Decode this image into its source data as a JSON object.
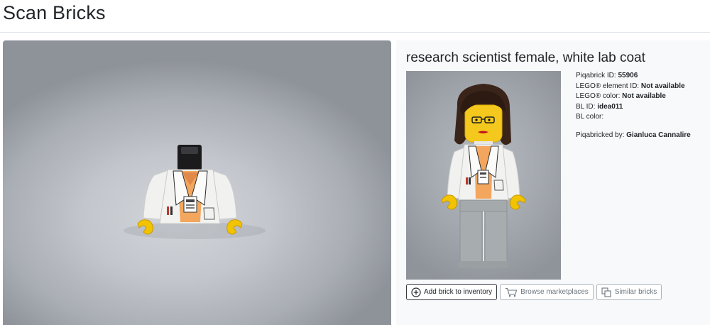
{
  "header": {
    "title": "Scan Bricks"
  },
  "brick": {
    "name": "research scientist female, white lab coat",
    "fields": [
      {
        "label": "Piqabrick ID: ",
        "value": "55906"
      },
      {
        "label": "LEGO® element ID: ",
        "value": "Not available"
      },
      {
        "label": "LEGO® color: ",
        "value": "Not available"
      },
      {
        "label": "BL ID: ",
        "value": "idea011"
      },
      {
        "label": "BL color: ",
        "value": ""
      }
    ],
    "piqabricked_by": {
      "label": "Piqabricked by: ",
      "value": "Gianluca Cannalire"
    }
  },
  "actions": {
    "add_label": "Add brick to inventory",
    "add_icon": "plus-circle-icon",
    "browse_label": "Browse marketplaces",
    "browse_icon": "cart-icon",
    "similar_label": "Similar bricks",
    "similar_icon": "copy-icon"
  },
  "colors": {
    "lab_coat": "#f2f2f0",
    "shirt_orange": "#f2a65e",
    "hands_yellow": "#f2c300",
    "legs_gray": "#a4a9ac",
    "hair_brown": "#3a2419"
  }
}
